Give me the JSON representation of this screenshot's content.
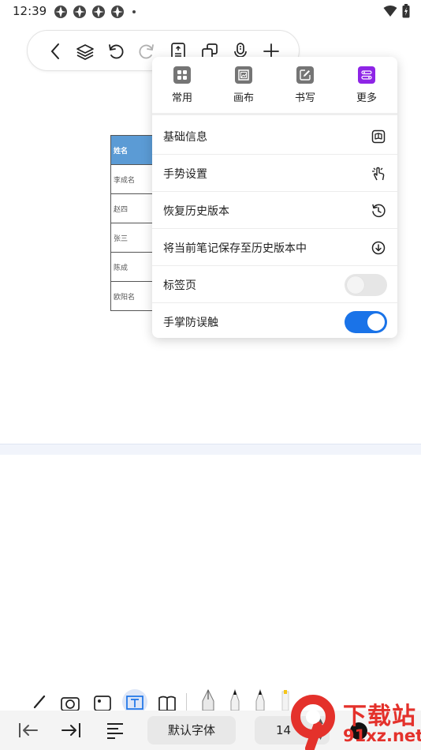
{
  "status_bar": {
    "time": "12:39"
  },
  "table": {
    "rows": [
      "姓名",
      "李成名",
      "赵四",
      "张三",
      "陈成",
      "欧阳名"
    ]
  },
  "menu": {
    "tabs": [
      {
        "label": "常用",
        "icon": "grid-icon",
        "color": "#757575"
      },
      {
        "label": "画布",
        "icon": "canvas-icon",
        "color": "#757575"
      },
      {
        "label": "书写",
        "icon": "pen-square-icon",
        "color": "#757575"
      },
      {
        "label": "更多",
        "icon": "sliders-icon",
        "color": "#8e24e6"
      }
    ],
    "items": [
      {
        "label": "基础信息",
        "icon": "book-icon"
      },
      {
        "label": "手势设置",
        "icon": "hand-gesture-icon"
      },
      {
        "label": "恢复历史版本",
        "icon": "history-icon"
      },
      {
        "label": "将当前笔记保存至历史版本中",
        "icon": "download-circle-icon"
      },
      {
        "label": "标签页",
        "toggle": false
      },
      {
        "label": "手掌防误触",
        "toggle": true
      }
    ]
  },
  "bottom_bar": {
    "font_name": "默认字体",
    "font_size": "14"
  },
  "watermark": {
    "text_top": "下载站",
    "text_bottom": "91xz.net"
  },
  "colors": {
    "accent": "#1a73e8",
    "more_tab": "#8e24e6",
    "header_cell": "#5b9bd5",
    "watermark": "#e4312b"
  }
}
